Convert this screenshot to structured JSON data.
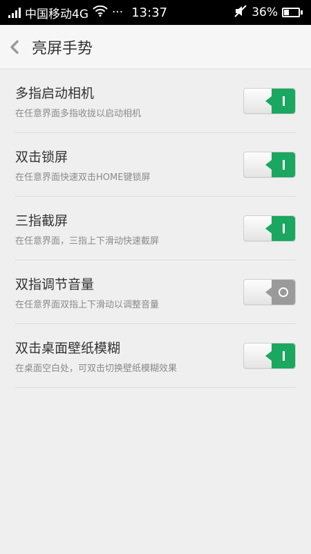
{
  "status_bar": {
    "carrier": "中国移动4G",
    "more": "···",
    "time": "13:37",
    "battery": "36%",
    "battery_level": 0.36,
    "icons": [
      "signal-icon",
      "wifi-icon",
      "mute-icon",
      "battery-icon"
    ]
  },
  "header": {
    "title": "亮屏手势",
    "back_icon": "chevron-left-icon"
  },
  "settings": [
    {
      "title": "多指启动相机",
      "subtitle": "在任意界面多指收拢以启动相机",
      "enabled": true
    },
    {
      "title": "双击锁屏",
      "subtitle": "在任意界面快速双击HOME键锁屏",
      "enabled": true
    },
    {
      "title": "三指截屏",
      "subtitle": "在任意界面，三指上下滑动快速截屏",
      "enabled": true
    },
    {
      "title": "双指调节音量",
      "subtitle": "在任意界面双指上下滑动以调整音量",
      "enabled": false
    },
    {
      "title": "双击桌面壁纸模糊",
      "subtitle": "在桌面空白处，可双击切换壁纸模糊效果",
      "enabled": true
    }
  ],
  "colors": {
    "toggle_on": "#1aa760",
    "toggle_off": "#9a9a9a"
  }
}
